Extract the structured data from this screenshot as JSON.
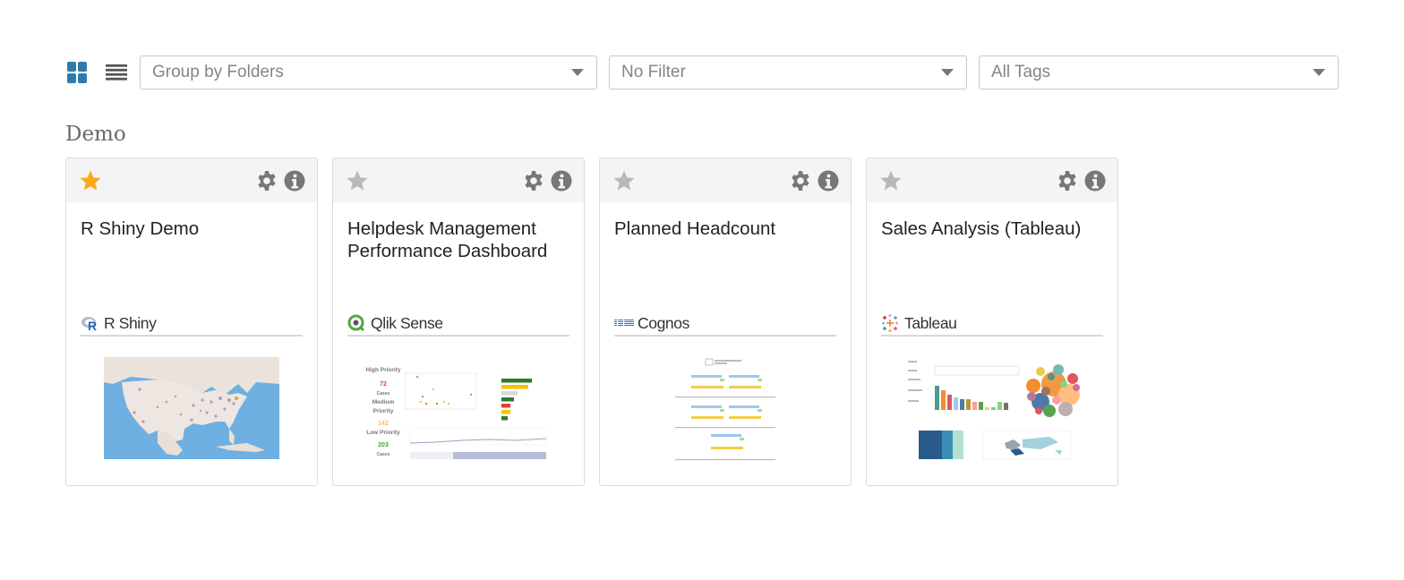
{
  "toolbar": {
    "grid_view_icon": "grid-icon",
    "list_view_icon": "list-icon",
    "group_select": {
      "value": "Group by Folders"
    },
    "filter_select": {
      "value": "No Filter"
    },
    "tags_select": {
      "value": "All Tags"
    }
  },
  "colors": {
    "accent": "#2e7cab",
    "favorite_star": "#f8a91b",
    "inactive_star": "#b8b8b8",
    "icon_gray": "#777777"
  },
  "section": {
    "title": "Demo"
  },
  "cards": [
    {
      "title": "R Shiny Demo",
      "favorite": true,
      "source": "R Shiny",
      "source_icon": "r-shiny-logo-icon",
      "thumbnail": "us-map-thumbnail"
    },
    {
      "title": "Helpdesk Management Performance Dashboard",
      "favorite": false,
      "source": "Qlik Sense",
      "source_icon": "qlik-logo-icon",
      "thumbnail": "helpdesk-dashboard-thumbnail",
      "thumb_text": {
        "high": "High Priority",
        "high_val": "72",
        "cases": "Cases",
        "medium": "Medium Priority",
        "medium_val": "142",
        "low": "Low Priority",
        "low_val": "203"
      }
    },
    {
      "title": "Planned Headcount",
      "favorite": false,
      "source": "Cognos",
      "source_icon": "ibm-logo-icon",
      "thumbnail": "headcount-report-thumbnail"
    },
    {
      "title": "Sales Analysis (Tableau)",
      "favorite": false,
      "source": "Tableau",
      "source_icon": "tableau-logo-icon",
      "thumbnail": "sales-dashboard-thumbnail"
    }
  ]
}
